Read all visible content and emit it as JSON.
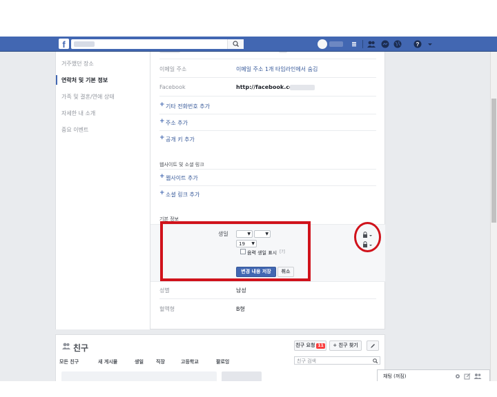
{
  "colors": {
    "brand": "#4267b2",
    "link": "#365899",
    "highlight": "#d0121b",
    "badge": "#fa3e3e"
  },
  "nav": {
    "logo": "f",
    "home_icon": "home-icon",
    "help_icon": "help-icon"
  },
  "sidebar": {
    "items": [
      {
        "label": "거주했던 장소"
      },
      {
        "label": "연락처 및 기본 정보"
      },
      {
        "label": "가족 및 결혼/연애 상태"
      },
      {
        "label": "자세한 내 소개"
      },
      {
        "label": "중요 이벤트"
      }
    ]
  },
  "contact": {
    "email_label": "이메일 주소",
    "email_value": "이메일 주소 1개 타임라인에서 숨김",
    "facebook_label": "Facebook",
    "facebook_value": "http://facebook.com/",
    "add_phone": "기타 전화번호 추가",
    "add_address": "주소 추가",
    "add_key": "공개 키 추가"
  },
  "websites": {
    "section_title": "웹사이트 및 소셜 링크",
    "add_website": "웹사이트 추가",
    "add_social": "소셜 링크 추가"
  },
  "basic": {
    "section_title": "기본 정보",
    "birthday_label": "생일",
    "year_value": "19",
    "show_lunar": "음력 생일 표시",
    "help": "[?]",
    "save_label": "변경 내용 저장",
    "cancel_label": "취소",
    "gender_label": "성별",
    "gender_value": "남성",
    "blood_label": "혈액형",
    "blood_value": "B형"
  },
  "friends": {
    "title": "친구",
    "request_label": "친구 요청",
    "request_count": "11",
    "find_label": "+ 친구 찾기",
    "tabs": [
      "모든 친구",
      "새 게시물",
      "생일",
      "직장",
      "고등학교",
      "팔로잉"
    ],
    "search_placeholder": "친구 검색"
  },
  "chat": {
    "label": "채팅 (꺼짐)"
  }
}
